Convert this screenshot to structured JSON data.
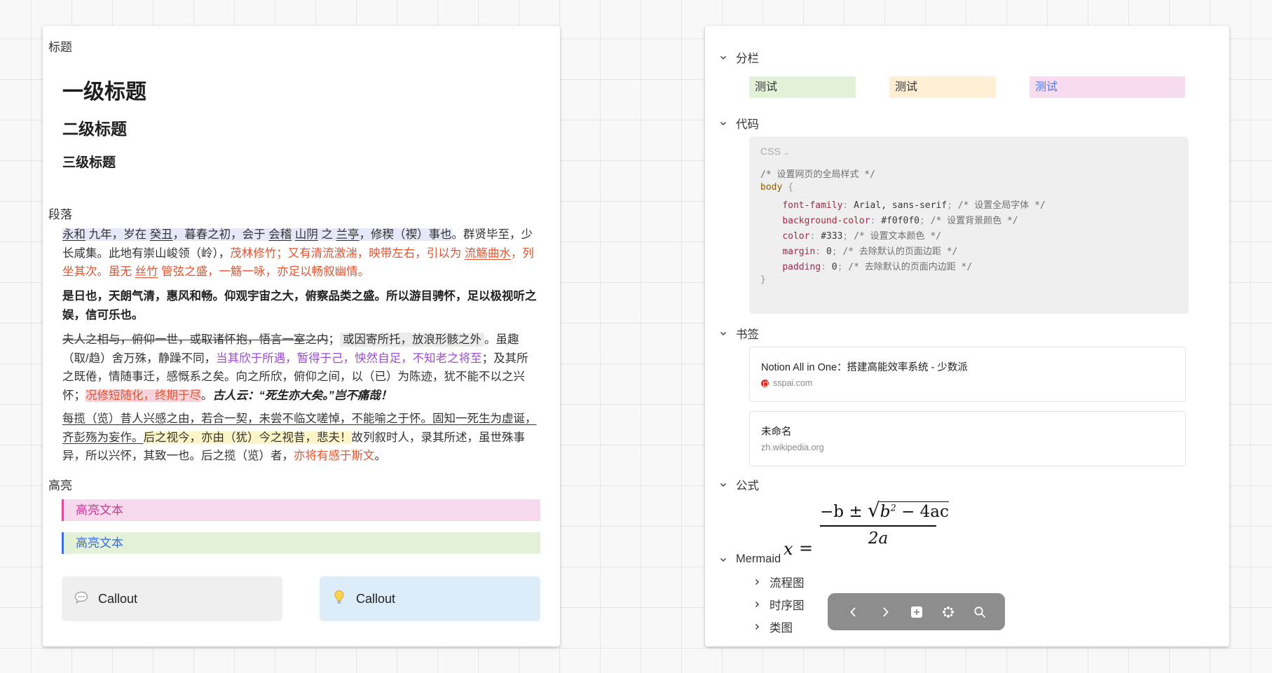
{
  "left": {
    "title_label": "标题",
    "h1": "一级标题",
    "h2": "二级标题",
    "h3": "三级标题",
    "paragraph_label": "段落",
    "p1": {
      "s1": "永和",
      "s2": " 九年，岁在 ",
      "s3": "癸丑",
      "s4": "，暮春之初，会于 ",
      "s5": "会稽",
      "s6": " ",
      "s7": "山阴",
      "s8": " 之 ",
      "s9": "兰亭",
      "s10": "，修稧（禊）事也",
      "s11": "。群贤毕至，少长咸集。此地有崇山峻领（岭），",
      "s12": "茂林修竹；又有清流激湍，映带左右，引以为 ",
      "s13": "流觞曲水",
      "s14": "，列坐其次。虽无 ",
      "s15": "丝竹",
      "s16": " 管弦之盛，一觞一咏，亦足以畅叙幽情。"
    },
    "p2": "是日也，天朗气清，惠风和畅。仰观宇宙之大，俯察品类之盛。所以游目骋怀，足以极视听之娱，信可乐也。",
    "p3": {
      "s1": "夫人之相与，俯仰一世，或取诸怀抱，悟言一室之内",
      "s2": "；",
      "s3": "或因寄所托，放浪形骸之外",
      "s4": "。虽趣（取/趋）舍万殊，静躁不同，",
      "s5": "当其欣于所遇，暂得于己，怏然自足，不知老之将至",
      "s6": "；及其所之既倦，情随事迁，感慨系之矣。向之所欣，俯仰之间，以（已）为陈迹，犹不能不以之兴怀；",
      "s7": "况修短随化，终期于尽",
      "s8": "。",
      "s9": "古人云：“死生亦大矣。”岂不痛哉！"
    },
    "p4": {
      "s1": "每揽（览）昔人兴感之由，若合一契，未尝不临文嗟悼，不能喻之于怀。",
      "s2": "固知一死生为虚诞，齐彭殇为妄作。",
      "s3": "后之视今，亦由（犹）今之视昔，悲夫！",
      "s4": "故列叙时人，录其所述，虽世殊事异，所以兴怀，其致一也。后之揽（览）者，",
      "s5": "亦将有感于斯文",
      "s6": "。"
    },
    "highlight_label": "高亮",
    "highlight_1": "高亮文本",
    "highlight_2": "高亮文本",
    "callout_1": "Callout",
    "callout_2": "Callout"
  },
  "right": {
    "columns_label": "分栏",
    "columns": [
      "测试",
      "测试",
      "测试"
    ],
    "code_label": "代码",
    "code_lang": "CSS",
    "code": {
      "l1": "/* 设置网页的全局样式 */",
      "l2_kw": "body",
      "l2_b": " {",
      "l3_p": "font-family",
      "l3_v": "Arial, sans-serif",
      "l3_c": "/* 设置全局字体 */",
      "l4_p": "background-color",
      "l4_v": "#f0f0f0",
      "l4_c": "/* 设置背景颜色 */",
      "l5_p": "color",
      "l5_v": "#333",
      "l5_c": "/* 设置文本颜色 */",
      "l6_p": "margin",
      "l6_v": "0",
      "l6_c": "/* 去除默认的页面边距 */",
      "l7_p": "padding",
      "l7_v": "0",
      "l7_c": "/* 去除默认的页面内边距 */",
      "l8": "}"
    },
    "bookmark_label": "书签",
    "bookmarks": [
      {
        "title": "Notion All in One：搭建高能效率系统 - 少数派",
        "url": "sspai.com"
      },
      {
        "title": "未命名",
        "url": "zh.wikipedia.org"
      }
    ],
    "formula_label": "公式",
    "formula": {
      "lhs": "x",
      "eq": "=",
      "minus_b": "−b",
      "pm": "±",
      "b2": "b",
      "exp": "2",
      "minus_4ac": " − 4ac",
      "denom": "2a"
    },
    "mermaid_label": "Mermaid",
    "mermaid_items": [
      "流程图",
      "时序图",
      "类图"
    ]
  },
  "colors": {
    "col_green": "#e3f1d8",
    "col_orange": "#fdeed4",
    "col_pink": "#f6dcee",
    "highlight_pink_bg": "#f6d9ec",
    "highlight_pink_border": "#e0489c",
    "highlight_pink_text": "#c83c91",
    "highlight_green_bg": "#e3f1d8",
    "highlight_green_border": "#3f6fe0",
    "highlight_green_text": "#3d6ad8",
    "callout_gray": "#efefef",
    "callout_blue": "#dcecf8",
    "toolbar_bg": "#8d8d8d"
  },
  "icons": {
    "callout_1": "speech-bubble-icon",
    "callout_2": "light-bulb-icon",
    "toolbar": [
      "chevron-left-icon",
      "chevron-right-icon",
      "plus-square-icon",
      "dots-grid-icon",
      "search-icon"
    ]
  }
}
